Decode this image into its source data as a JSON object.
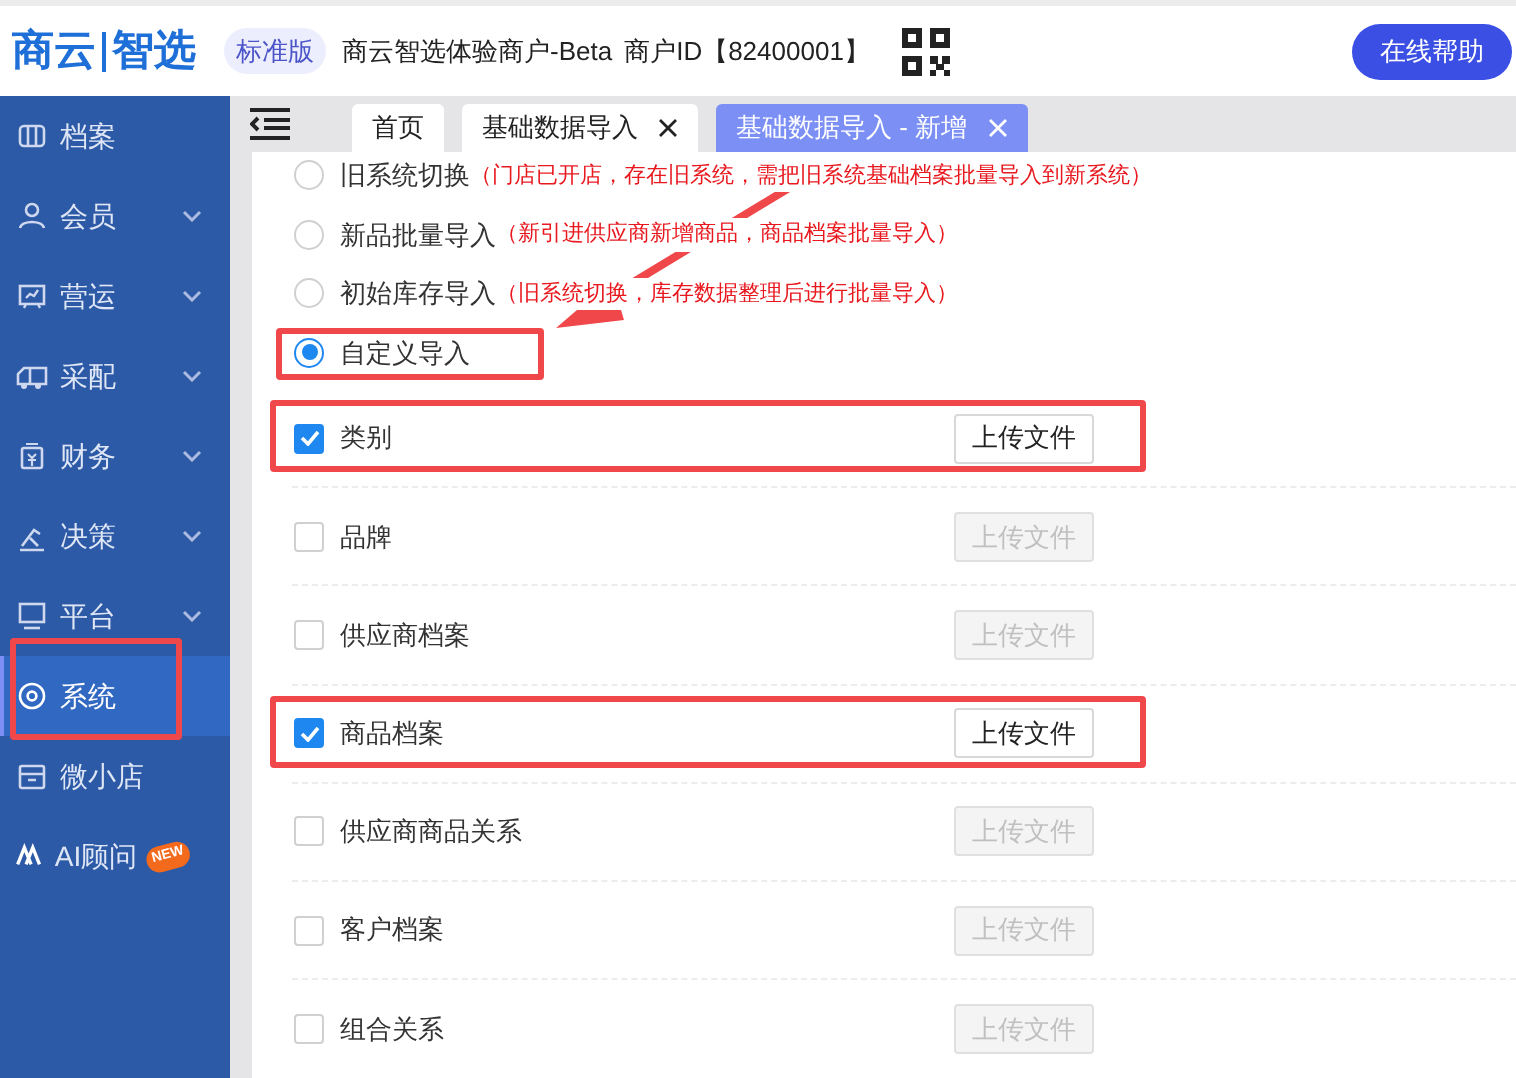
{
  "header": {
    "logo_left": "商云",
    "logo_right": "智选",
    "edition_badge": "标准版",
    "merchant_name": "商云智选体验商户-Beta",
    "merchant_id": "商户ID【82400001】",
    "help_button": "在线帮助"
  },
  "sidebar": {
    "items": [
      {
        "label": "档案",
        "has_chevron": false,
        "selected": false,
        "highlighted": false
      },
      {
        "label": "会员",
        "has_chevron": true,
        "selected": false,
        "highlighted": false
      },
      {
        "label": "营运",
        "has_chevron": true,
        "selected": false,
        "highlighted": false
      },
      {
        "label": "采配",
        "has_chevron": true,
        "selected": false,
        "highlighted": false
      },
      {
        "label": "财务",
        "has_chevron": true,
        "selected": false,
        "highlighted": false
      },
      {
        "label": "决策",
        "has_chevron": true,
        "selected": false,
        "highlighted": false
      },
      {
        "label": "平台",
        "has_chevron": true,
        "selected": false,
        "highlighted": false
      },
      {
        "label": "系统",
        "has_chevron": false,
        "selected": true,
        "highlighted": true
      },
      {
        "label": "微小店",
        "has_chevron": false,
        "selected": false,
        "highlighted": false
      },
      {
        "label": "AI顾问",
        "has_chevron": false,
        "selected": false,
        "highlighted": false,
        "badge": "NEW"
      }
    ]
  },
  "tabs": [
    {
      "label": "首页",
      "closable": false,
      "selected": false
    },
    {
      "label": "基础数据导入",
      "closable": true,
      "selected": false
    },
    {
      "label": "基础数据导入 - 新增",
      "closable": true,
      "selected": true
    }
  ],
  "import_modes": [
    {
      "label": "旧系统切换",
      "note": "（门店已开店，存在旧系统，需把旧系统基础档案批量导入到新系统）",
      "selected": false,
      "highlighted": false
    },
    {
      "label": "新品批量导入",
      "note": "（新引进供应商新增商品，商品档案批量导入）",
      "selected": false,
      "highlighted": false
    },
    {
      "label": "初始库存导入",
      "note": "（旧系统切换，库存数据整理后进行批量导入）",
      "selected": false,
      "highlighted": false
    },
    {
      "label": "自定义导入",
      "selected": true,
      "highlighted": true
    }
  ],
  "import_items": [
    {
      "label": "类别",
      "checked": true,
      "highlighted": true,
      "button": "上传文件"
    },
    {
      "label": "品牌",
      "checked": false,
      "highlighted": false,
      "button": "上传文件"
    },
    {
      "label": "供应商档案",
      "checked": false,
      "highlighted": false,
      "button": "上传文件"
    },
    {
      "label": "商品档案",
      "checked": true,
      "highlighted": true,
      "button": "上传文件"
    },
    {
      "label": "供应商商品关系",
      "checked": false,
      "highlighted": false,
      "button": "上传文件"
    },
    {
      "label": "客户档案",
      "checked": false,
      "highlighted": false,
      "button": "上传文件"
    },
    {
      "label": "组合关系",
      "checked": false,
      "highlighted": false,
      "button": "上传文件"
    }
  ]
}
